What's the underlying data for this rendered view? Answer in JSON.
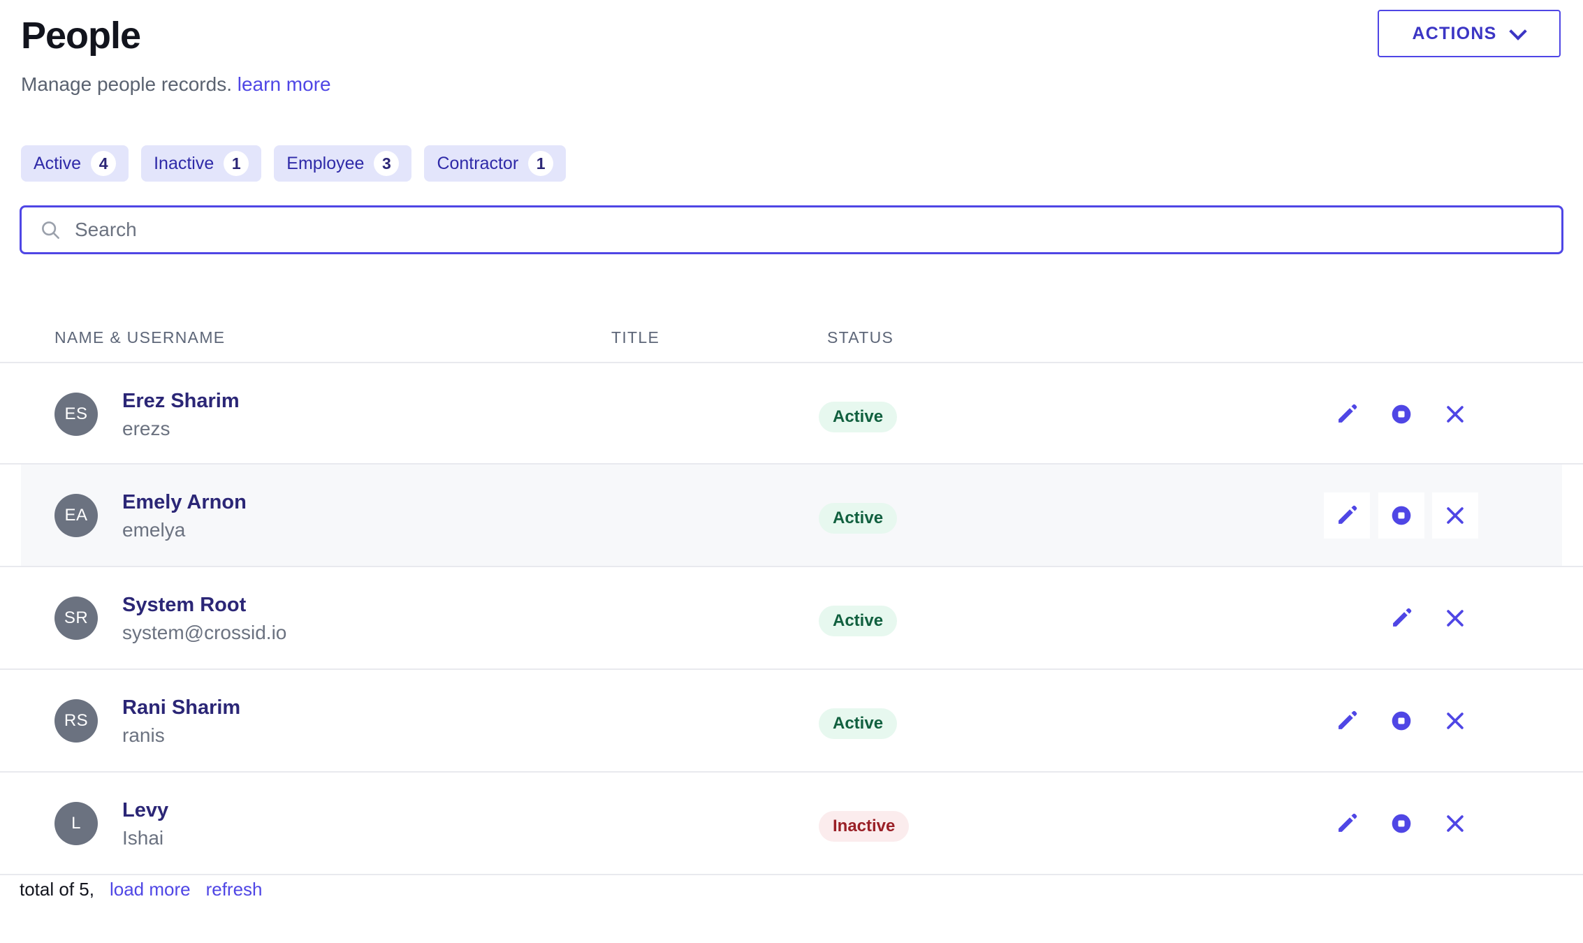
{
  "header": {
    "title": "People",
    "subtitle_text": "Manage people records.",
    "subtitle_link": "learn more",
    "actions_label": "ACTIONS",
    "chevron_icon": "chevron-down-icon"
  },
  "filters": [
    {
      "label": "Active",
      "count": "4"
    },
    {
      "label": "Inactive",
      "count": "1"
    },
    {
      "label": "Employee",
      "count": "3"
    },
    {
      "label": "Contractor",
      "count": "1"
    }
  ],
  "search": {
    "placeholder": "Search",
    "value": "",
    "icon": "search-icon"
  },
  "table": {
    "columns": [
      {
        "key": "name",
        "label": "NAME & USERNAME"
      },
      {
        "key": "title",
        "label": "TITLE"
      },
      {
        "key": "status",
        "label": "STATUS"
      }
    ],
    "rows": [
      {
        "initials": "ES",
        "name": "Erez Sharim",
        "username": "erezs",
        "title": "",
        "status": "Active",
        "status_kind": "active",
        "hovered": false,
        "actions": [
          "edit-icon",
          "block-icon",
          "close-icon"
        ]
      },
      {
        "initials": "EA",
        "name": "Emely Arnon",
        "username": "emelya",
        "title": "",
        "status": "Active",
        "status_kind": "active",
        "hovered": true,
        "actions": [
          "edit-icon",
          "block-icon",
          "close-icon"
        ]
      },
      {
        "initials": "SR",
        "name": "System Root",
        "username": "system@crossid.io",
        "title": "",
        "status": "Active",
        "status_kind": "active",
        "hovered": false,
        "actions": [
          "",
          "edit-icon",
          "close-icon"
        ]
      },
      {
        "initials": "RS",
        "name": "Rani Sharim",
        "username": "ranis",
        "title": "",
        "status": "Active",
        "status_kind": "active",
        "hovered": false,
        "actions": [
          "edit-icon",
          "block-icon",
          "close-icon"
        ]
      },
      {
        "initials": "L",
        "name": "Levy",
        "username": "Ishai",
        "title": "",
        "status": "Inactive",
        "status_kind": "inactive",
        "hovered": false,
        "actions": [
          "edit-icon",
          "block-icon",
          "close-icon"
        ]
      }
    ]
  },
  "footer": {
    "total_text": "total of 5,",
    "load_more_label": "load more",
    "refresh_label": "refresh"
  },
  "colors": {
    "accent": "#4f46e5",
    "accent_dark": "#2b2676",
    "chip_bg": "#e3e5fb",
    "avatar_bg": "#6b7280",
    "row_hover": "#f7f8fa",
    "badge_active_bg": "#e7f8ef",
    "badge_active_fg": "#11603f",
    "badge_inactive_bg": "#fbeced",
    "badge_inactive_fg": "#9a2027",
    "divider": "#e8e9ee"
  }
}
